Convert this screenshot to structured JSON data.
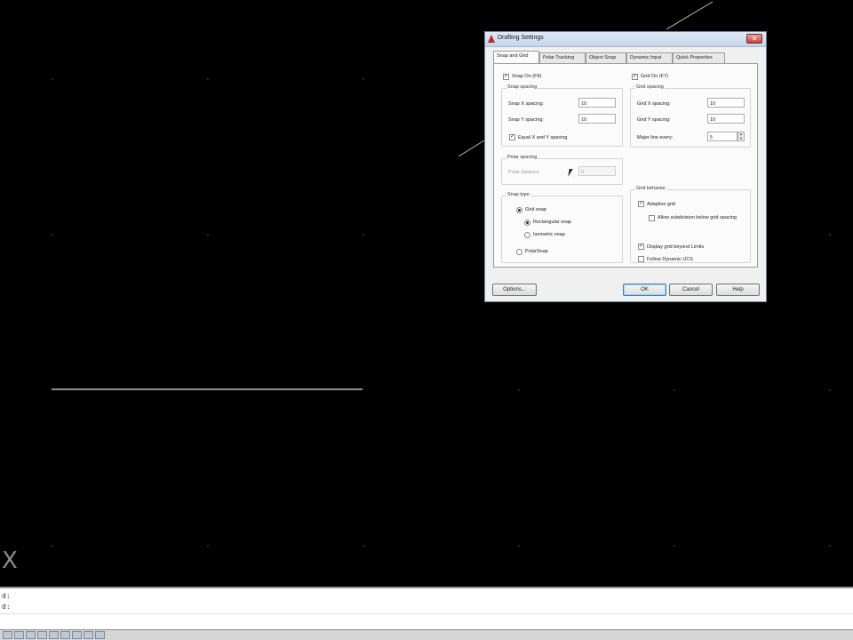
{
  "canvas": {
    "ucs_label": "X"
  },
  "dialog": {
    "title": "Drafting Settings",
    "close_glyph": "✕",
    "tabs": [
      {
        "label": "Snap and Grid"
      },
      {
        "label": "Polar Tracking"
      },
      {
        "label": "Object Snap"
      },
      {
        "label": "Dynamic Input"
      },
      {
        "label": "Quick Properties"
      }
    ],
    "snap_on": {
      "label": "Snap On (F9)",
      "checked": "✓"
    },
    "snap_spacing": {
      "title": "Snap spacing",
      "x_label": "Snap X spacing:",
      "x_value": "10",
      "y_label": "Snap Y spacing:",
      "y_value": "10",
      "equal_label": "Equal X and Y spacing",
      "equal_checked": "✓"
    },
    "polar_spacing": {
      "title": "Polar spacing",
      "distance_label": "Polar distance:",
      "distance_value": "0"
    },
    "snap_type": {
      "title": "Snap type",
      "grid_snap": "Grid snap",
      "rectangular": "Rectangular snap",
      "isometric": "Isometric snap",
      "polar": "PolarSnap"
    },
    "grid_on": {
      "label": "Grid On (F7)",
      "checked": "✓"
    },
    "grid_spacing": {
      "title": "Grid spacing",
      "x_label": "Grid X spacing:",
      "x_value": "10",
      "y_label": "Grid Y spacing:",
      "y_value": "10",
      "major_label": "Major line every:",
      "major_value": "5"
    },
    "grid_behavior": {
      "title": "Grid behavior",
      "adaptive": "Adaptive grid",
      "adaptive_checked": "✓",
      "subdivision": "Allow subdivision below grid spacing",
      "beyond_limits": "Display grid beyond Limits",
      "beyond_checked": "✓",
      "follow_ucs": "Follow Dynamic UCS"
    },
    "buttons": {
      "options": "Options...",
      "ok": "OK",
      "cancel": "Cancel",
      "help": "Help"
    }
  },
  "command_line": {
    "line1": "d:",
    "line2": "d:"
  }
}
